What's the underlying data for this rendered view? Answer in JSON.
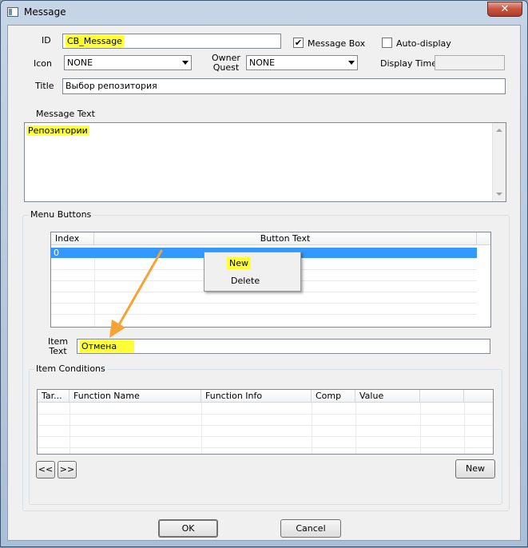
{
  "window": {
    "title": "Message",
    "close_glyph": "✕"
  },
  "fields": {
    "id_label": "ID",
    "id_value": "CB_Message",
    "message_box_label": "Message Box",
    "message_box_checked": true,
    "auto_display_label": "Auto-display",
    "auto_display_checked": false,
    "icon_label": "Icon",
    "icon_value": "NONE",
    "owner_label_line1": "Owner",
    "owner_label_line2": "Quest",
    "owner_value": "NONE",
    "display_time_label": "Display Time",
    "display_time_value": "",
    "title_label": "Title",
    "title_value": "Выбор репозитория",
    "message_text_label": "Message Text",
    "message_text_value": "Репозитории"
  },
  "menu_buttons": {
    "group_label": "Menu Buttons",
    "columns": [
      "Index",
      "Button Text"
    ],
    "rows": [
      {
        "index": "0",
        "text": ""
      }
    ],
    "item_text_label_line1": "Item",
    "item_text_label_line2": "Text",
    "item_text_value": "Отмена"
  },
  "context_menu": {
    "items": [
      "New",
      "Delete"
    ]
  },
  "item_conditions": {
    "group_label": "Item Conditions",
    "columns": [
      "Tar...",
      "Function Name",
      "Function Info",
      "Comp",
      "Value",
      "",
      ""
    ],
    "prev_label": "<<",
    "next_label": ">>",
    "new_label": "New"
  },
  "footer": {
    "ok_label": "OK",
    "cancel_label": "Cancel"
  },
  "colors": {
    "highlight": "#ffff33",
    "selection": "#3399ff",
    "annotation_arrow": "#f7a234"
  },
  "icons": {
    "checkbox_checked": "✔"
  }
}
